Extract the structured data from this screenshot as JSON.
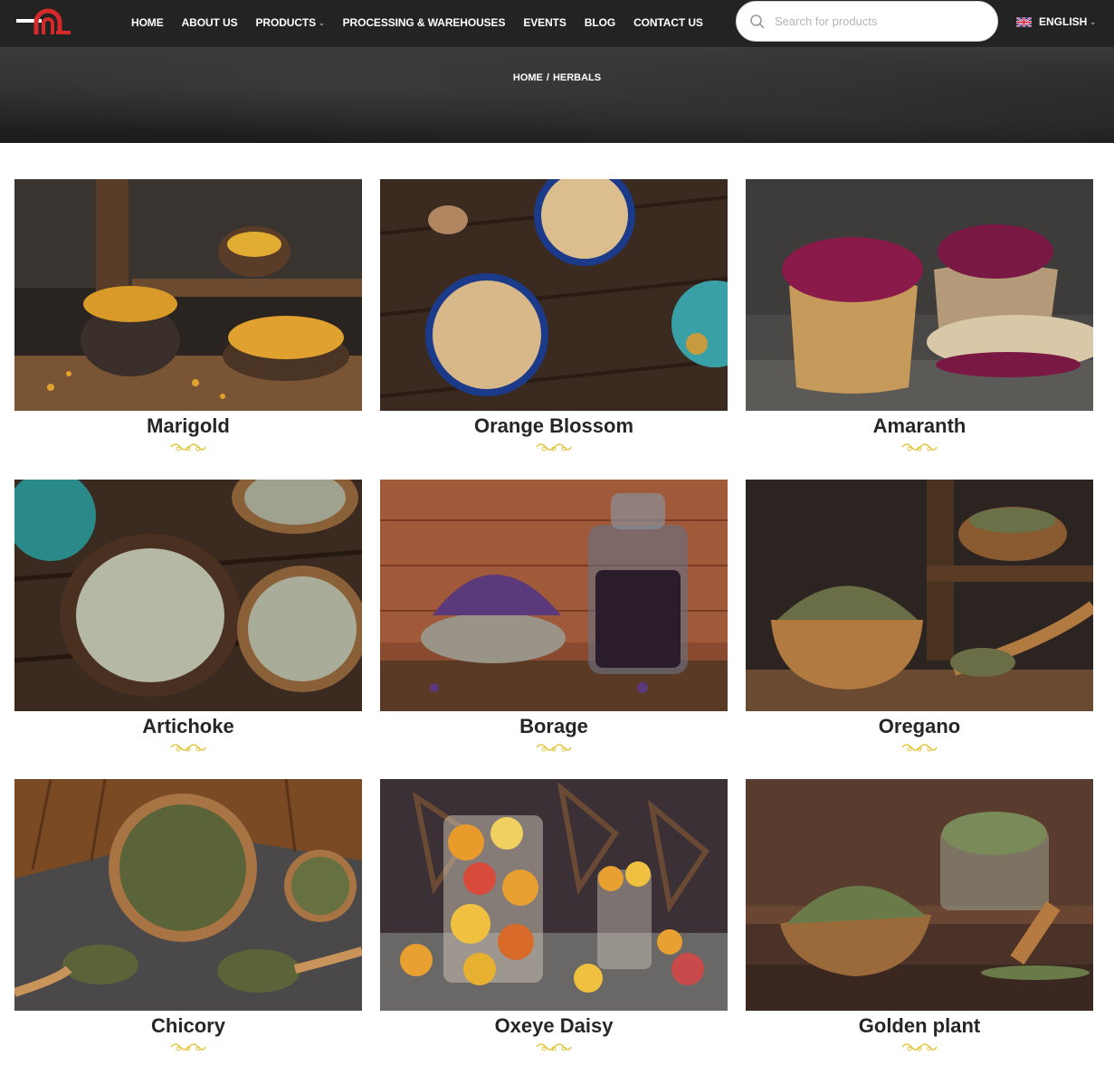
{
  "brand": {
    "logo_icon": "brand-logo-icon"
  },
  "nav": {
    "items": [
      {
        "label": "HOME"
      },
      {
        "label": "ABOUT US"
      },
      {
        "label": "PRODUCTS",
        "has_dropdown": true
      },
      {
        "label": "PROCESSING & WAREHOUSES"
      },
      {
        "label": "EVENTS"
      },
      {
        "label": "BLOG"
      },
      {
        "label": "CONTACT US"
      }
    ]
  },
  "search": {
    "placeholder": "Search for products",
    "icon": "search-icon"
  },
  "language": {
    "label": "ENGLISH",
    "flag": "uk-flag-icon"
  },
  "breadcrumb": {
    "home": "HOME",
    "separator": "/",
    "current": "HERBALS"
  },
  "products": [
    {
      "name": "Marigold"
    },
    {
      "name": "Orange Blossom"
    },
    {
      "name": "Amaranth"
    },
    {
      "name": "Artichoke"
    },
    {
      "name": "Borage"
    },
    {
      "name": "Oregano"
    },
    {
      "name": "Chicory"
    },
    {
      "name": "Oxeye Daisy"
    },
    {
      "name": "Golden plant"
    }
  ],
  "colors": {
    "header_bg": "#232323",
    "ornament": "#e2c53a",
    "title_text": "#262626"
  }
}
